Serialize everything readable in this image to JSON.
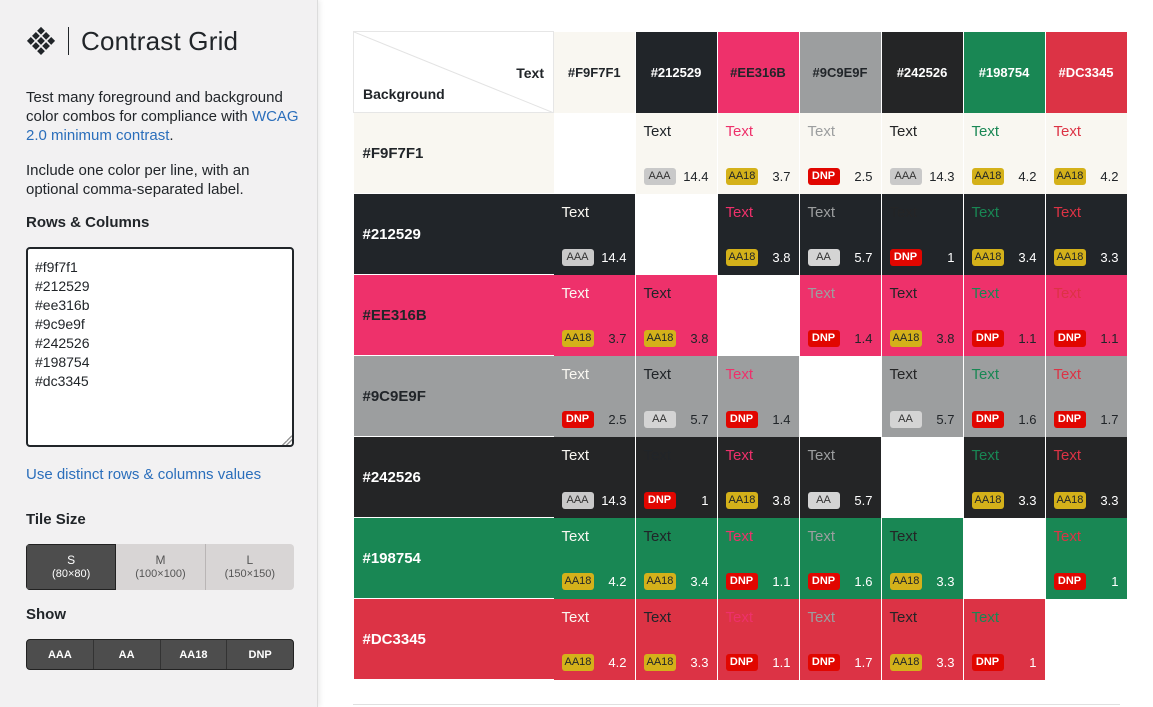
{
  "app": {
    "title": "Contrast Grid",
    "intro_prefix": "Test many foreground and background color combos for compliance with ",
    "intro_link": "WCAG 2.0 minimum contrast",
    "intro_suffix": ".",
    "intro2": "Include one color per line, with an optional comma-separated label."
  },
  "rows_columns": {
    "label": "Rows & Columns",
    "value": "#f9f7f1\n#212529\n#ee316b\n#9c9e9f\n#242526\n#198754\n#dc3345"
  },
  "distinct_link": "Use distinct rows & columns values",
  "tile_size": {
    "label": "Tile Size",
    "options": [
      {
        "size": "S",
        "dims": "(80×80)",
        "active": true
      },
      {
        "size": "M",
        "dims": "(100×100)",
        "active": false
      },
      {
        "size": "L",
        "dims": "(150×150)",
        "active": false
      }
    ]
  },
  "show": {
    "label": "Show",
    "options": [
      "AAA",
      "AA",
      "AA18",
      "DNP"
    ]
  },
  "grid": {
    "corner_text": "Text",
    "corner_background": "Background",
    "sample_text": "Text",
    "colors": [
      {
        "label": "#F9F7F1",
        "hex": "#f9f7f1",
        "fg": "#212529"
      },
      {
        "label": "#212529",
        "hex": "#212529",
        "fg": "#ffffff"
      },
      {
        "label": "#EE316B",
        "hex": "#ee316b",
        "fg": "#212529"
      },
      {
        "label": "#9C9E9F",
        "hex": "#9c9e9f",
        "fg": "#212529"
      },
      {
        "label": "#242526",
        "hex": "#242526",
        "fg": "#ffffff"
      },
      {
        "label": "#198754",
        "hex": "#198754",
        "fg": "#ffffff"
      },
      {
        "label": "#DC3345",
        "hex": "#dc3345",
        "fg": "#ffffff"
      }
    ],
    "cells": [
      [
        null,
        [
          "AAA",
          "14.4"
        ],
        [
          "AA18",
          "3.7"
        ],
        [
          "DNP",
          "2.5"
        ],
        [
          "AAA",
          "14.3"
        ],
        [
          "AA18",
          "4.2"
        ],
        [
          "AA18",
          "4.2"
        ]
      ],
      [
        [
          "AAA",
          "14.4"
        ],
        null,
        [
          "AA18",
          "3.8"
        ],
        [
          "AA",
          "5.7"
        ],
        [
          "DNP",
          "1"
        ],
        [
          "AA18",
          "3.4"
        ],
        [
          "AA18",
          "3.3"
        ]
      ],
      [
        [
          "AA18",
          "3.7"
        ],
        [
          "AA18",
          "3.8"
        ],
        null,
        [
          "DNP",
          "1.4"
        ],
        [
          "AA18",
          "3.8"
        ],
        [
          "DNP",
          "1.1"
        ],
        [
          "DNP",
          "1.1"
        ]
      ],
      [
        [
          "DNP",
          "2.5"
        ],
        [
          "AA",
          "5.7"
        ],
        [
          "DNP",
          "1.4"
        ],
        null,
        [
          "AA",
          "5.7"
        ],
        [
          "DNP",
          "1.6"
        ],
        [
          "DNP",
          "1.7"
        ]
      ],
      [
        [
          "AAA",
          "14.3"
        ],
        [
          "DNP",
          "1"
        ],
        [
          "AA18",
          "3.8"
        ],
        [
          "AA",
          "5.7"
        ],
        null,
        [
          "AA18",
          "3.3"
        ],
        [
          "AA18",
          "3.3"
        ]
      ],
      [
        [
          "AA18",
          "4.2"
        ],
        [
          "AA18",
          "3.4"
        ],
        [
          "DNP",
          "1.1"
        ],
        [
          "DNP",
          "1.6"
        ],
        [
          "AA18",
          "3.3"
        ],
        null,
        [
          "DNP",
          "1"
        ]
      ],
      [
        [
          "AA18",
          "4.2"
        ],
        [
          "AA18",
          "3.3"
        ],
        [
          "DNP",
          "1.1"
        ],
        [
          "DNP",
          "1.7"
        ],
        [
          "AA18",
          "3.3"
        ],
        [
          "DNP",
          "1"
        ],
        null
      ]
    ]
  }
}
